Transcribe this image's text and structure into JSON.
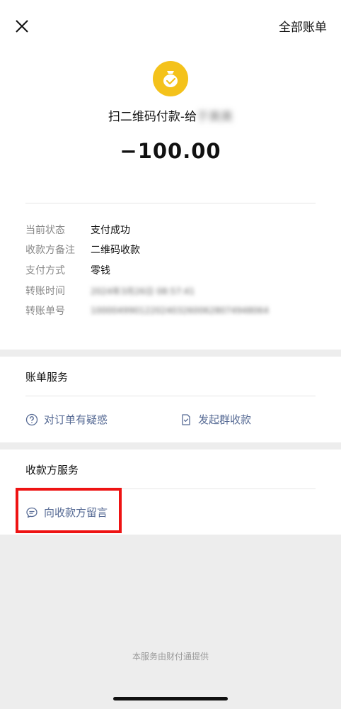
{
  "header": {
    "all_bills_label": "全部账单"
  },
  "transaction": {
    "title_prefix": "扫二维码付款-给",
    "payee_blurred": "于美美",
    "amount": "−100.00"
  },
  "details": [
    {
      "label": "当前状态",
      "value": "支付成功"
    },
    {
      "label": "收款方备注",
      "value": "二维码收款"
    },
    {
      "label": "支付方式",
      "value": "零钱"
    },
    {
      "label": "转账时间",
      "value": "2024年3月26日 08:57:41"
    },
    {
      "label": "转账单号",
      "value": "100004990122024032600628074948064"
    }
  ],
  "bill_services": {
    "title": "账单服务",
    "question_label": "对订单有疑惑",
    "group_collect_label": "发起群收款"
  },
  "payee_services": {
    "title": "收款方服务",
    "message_label": "向收款方留言"
  },
  "footer": {
    "note": "本服务由财付通提供"
  },
  "colors": {
    "accent_link": "#576b95",
    "logo_yellow": "#f4c21b",
    "highlight_red": "#ee1313"
  }
}
